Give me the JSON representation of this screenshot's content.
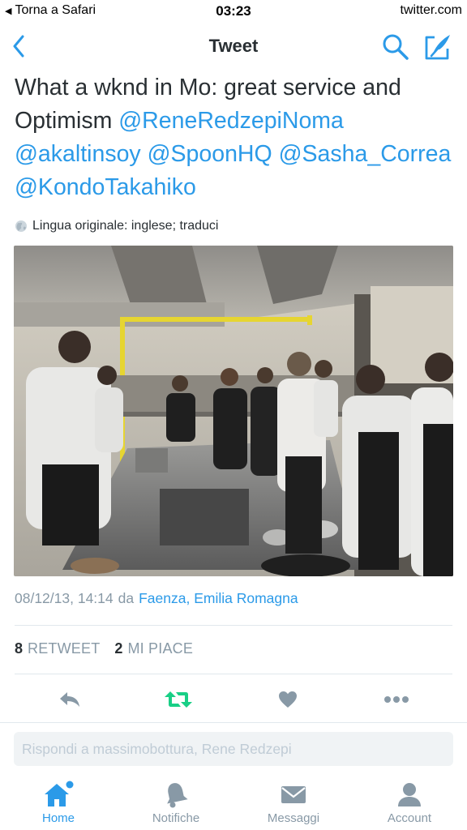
{
  "status_bar": {
    "back_app": "Torna a Safari",
    "time": "03:23",
    "domain": "twitter.com"
  },
  "nav": {
    "title": "Tweet",
    "back_icon": "chevron-left-icon",
    "search_icon": "search-icon",
    "compose_icon": "compose-icon"
  },
  "tweet": {
    "text_line1": "What a wknd in Mo: great service and",
    "text_plain2": "Optimism ",
    "mentions": [
      "@ReneRedzepiNoma",
      "@akaltinsoy",
      "@SpoonHQ",
      "@Sasha_Correa",
      "@KondoTakahiko"
    ],
    "translate": "Lingua originale: inglese; traduci",
    "date": "08/12/13, 14:14",
    "from": "da",
    "place": "Faenza, Emilia Romagna"
  },
  "stats": {
    "retweets_count": "8",
    "retweets_label": "RETWEET",
    "likes_count": "2",
    "likes_label": "MI PIACE"
  },
  "actions": [
    "reply-icon",
    "retweet-icon",
    "heart-icon",
    "more-icon"
  ],
  "reply": {
    "placeholder": "Rispondi a massimobottura, Rene Redzepi"
  },
  "tabs": [
    {
      "label": "Home",
      "icon": "home-icon",
      "active": true
    },
    {
      "label": "Notifiche",
      "icon": "bell-icon",
      "active": false
    },
    {
      "label": "Messaggi",
      "icon": "envelope-icon",
      "active": false
    },
    {
      "label": "Account",
      "icon": "person-icon",
      "active": false
    }
  ],
  "colors": {
    "accent": "#2b9ae8",
    "retweet": "#19cf86",
    "muted": "#8899a6",
    "icon_gray": "#8899a6"
  }
}
